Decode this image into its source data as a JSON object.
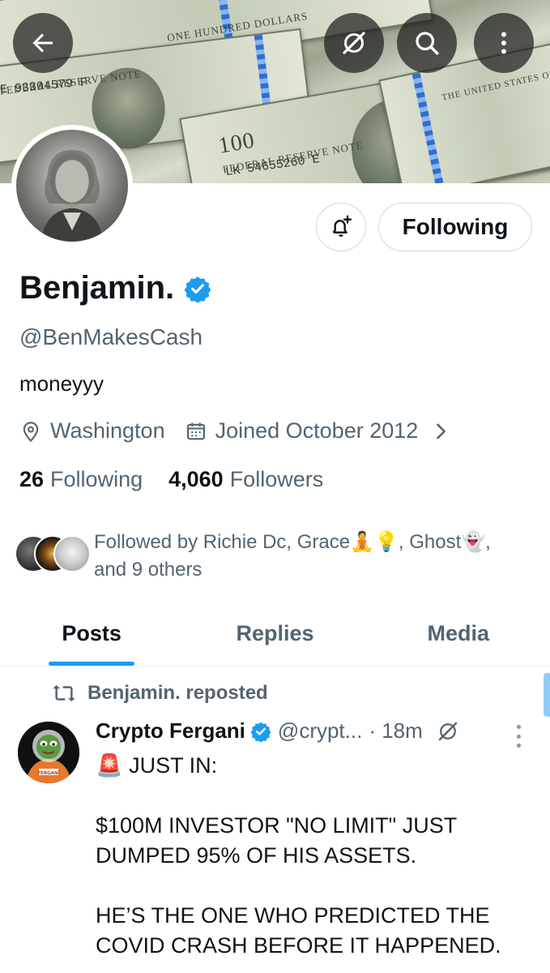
{
  "banner": {
    "bill_text_top": "ONE HUNDRED DOLLARS",
    "bill_text_left": "FEDERAL RESERVE NOTE",
    "serial_left": "E 93304579 F",
    "bill_text_center": "FEDERAL RESERVE NOTE",
    "serial_center": "LK 54655260 E",
    "denomination": "100",
    "bill_text_right": "THE UNITED STATES OF AMERICA"
  },
  "header": {
    "back_icon": "arrow-left-icon",
    "grok_icon": "grok-icon",
    "search_icon": "search-icon",
    "more_icon": "more-vertical-icon"
  },
  "profile": {
    "display_name": "Benjamin.",
    "verified_icon": "verified-badge-icon",
    "handle": "@BenMakesCash",
    "bio": "moneyyy",
    "location": "Washington",
    "joined": "Joined October 2012",
    "following_count": "26",
    "following_label": "Following",
    "followers_count": "4,060",
    "followers_label": "Followers",
    "followed_by": "Followed by Richie Dc, Grace🧘💡, Ghost👻, and 9 others",
    "following_button": "Following"
  },
  "tabs": [
    {
      "label": "Posts",
      "active": true
    },
    {
      "label": "Replies",
      "active": false
    },
    {
      "label": "Media",
      "active": false
    }
  ],
  "post": {
    "repost_label": "Benjamin. reposted",
    "author": "Crypto Fergani",
    "handle": "@crypt...",
    "time": "· 18m",
    "avatar_text": "FERGANI",
    "line1": "🚨 JUST IN:",
    "line2": "$100M INVESTOR \"NO LIMIT\" JUST DUMPED 95% OF HIS ASSETS.",
    "line3": "HE’S THE ONE WHO PREDICTED THE COVID CRASH BEFORE IT HAPPENED."
  },
  "colors": {
    "accent": "#1d9bf0",
    "text_primary": "#0f1419",
    "text_secondary": "#536471",
    "border": "#cfd9de"
  }
}
